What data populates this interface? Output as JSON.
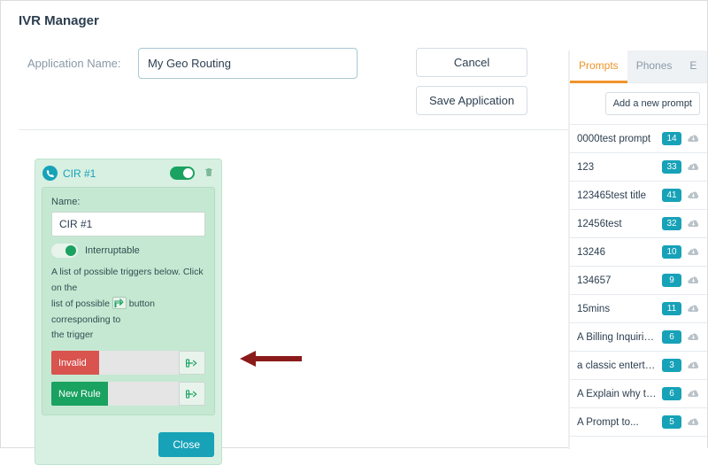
{
  "page_title": "IVR Manager",
  "form": {
    "app_name_label": "Application Name:",
    "app_name_value": "My Geo Routing",
    "cancel_label": "Cancel",
    "save_label": "Save Application"
  },
  "card": {
    "header_title": "CIR #1",
    "name_label": "Name:",
    "name_value": "CIR #1",
    "interruptable_label": "Interruptable",
    "help_text_1": "A list of possible triggers below. Click on the",
    "help_text_2a": "list of possible",
    "help_text_2b": "button corresponding to",
    "help_text_3": "the trigger",
    "triggers": {
      "invalid": "Invalid",
      "newrule": "New Rule"
    },
    "close_label": "Close"
  },
  "right_panel": {
    "tabs": {
      "prompts": "Prompts",
      "phones": "Phones",
      "extra": "E"
    },
    "add_label": "Add a new prompt",
    "items": [
      {
        "name": "0000test prompt",
        "count": "14"
      },
      {
        "name": "123",
        "count": "33"
      },
      {
        "name": "123465test title",
        "count": "41"
      },
      {
        "name": "12456test",
        "count": "32"
      },
      {
        "name": "13246",
        "count": "10"
      },
      {
        "name": "134657",
        "count": "9"
      },
      {
        "name": "15mins",
        "count": "11"
      },
      {
        "name": "A Billing Inquiries...",
        "count": "6"
      },
      {
        "name": "a classic entert w...",
        "count": "3"
      },
      {
        "name": "A Explain why th...",
        "count": "6"
      },
      {
        "name": "A Prompt to...",
        "count": "5"
      }
    ]
  }
}
